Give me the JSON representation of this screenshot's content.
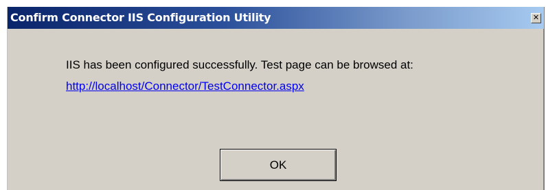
{
  "window": {
    "title": "Confirm Connector IIS Configuration Utility",
    "close_glyph": "✕"
  },
  "content": {
    "message": "IIS has been configured successfully. Test page can be browsed at:",
    "link": "http://localhost/Connector/TestConnector.aspx"
  },
  "buttons": {
    "ok_label": "OK"
  },
  "colors": {
    "title_bar_start": "#0a246a",
    "title_bar_end": "#a6caf0",
    "dialog_background": "#d4d0c8",
    "link": "#0000ee"
  }
}
